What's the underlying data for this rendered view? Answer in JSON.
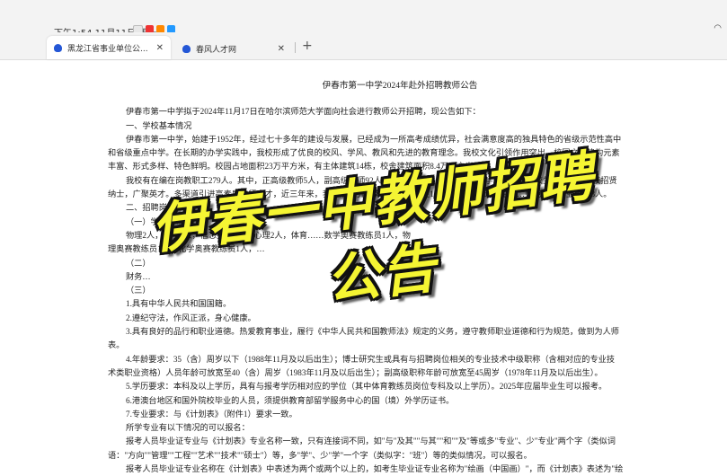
{
  "status": {
    "time": "下午1:54 11月11日 周一"
  },
  "tabs": [
    {
      "label": "黑龙江省事业单位公...",
      "close": "✕"
    },
    {
      "label": "春风人才网",
      "close": "✕"
    }
  ],
  "newtab": "+",
  "doc": {
    "title": "伊春市第一中学2024年赴外招聘教师公告",
    "lines": [
      "伊春市第一中学拟于2024年11月17日在哈尔滨师范大学面向社会进行教师公开招聘，现公告如下：",
      "一、学校基本情况",
      "伊春市第一中学，始建于1952年，经过七十多年的建设与发展，已经成为一所高考成绩优异，社会满意度高的独具特色的省级示范性高中",
      "和省级重点中学。在长期的办学实践中，我校形成了优良的校风、学风、教风和先进的教育理念。我校文化引领作用突出，校园文化建构元素",
      "丰富、形式多样、特色鲜明。校园占地面积23万平方米，有主体建筑14栋，校舍建筑面积8.4万平方米。",
      "我校有在编在岗教职工279人。其中，正高级教师5人，副高级教师92人，博士1人，硕士39人。有教学班59个，在校生2845人。我校招贤",
      "纳士，广聚英才。多渠道引进高素质教师人才，近三年来，我校成功引进南京大学博士生1人，招聘硕士研究生……师范大学毕业生103人。",
      "二、招聘岗位",
      "（一）学科岗位",
      "物理2人，化学3人，信息技术2人，心理2人，体育……数学奥赛教练员1人，物",
      "理奥赛教练员1人，化学奥赛教练员1人，…",
      "（二）",
      "财务…",
      "（三）",
      "1.具有中华人民共和国国籍。",
      "2.遵纪守法，作风正派，身心健康。",
      "3.具有良好的品行和职业道德。热爱教育事业，履行《中华人民共和国教师法》规定的义务，遵守教师职业道德和行为规范，做到为人师",
      "表。",
      "4.年龄要求：35（含）周岁以下（1988年11月及以后出生）；博士研究生或具有与招聘岗位相关的专业技术中级职称（含相对应的专业技",
      "术类职业资格）人员年龄可放宽至40（含）周岁（1983年11月及以后出生）；副高级职称年龄可放宽至45周岁（1978年11月及以后出生）。",
      "5.学历要求：本科及以上学历，具有与报考学历相对应的学位（其中体育教练员岗位专科及以上学历）。2025年应届毕业生可以报考。",
      "6.港澳台地区和国外院校毕业的人员，须提供教育部留学服务中心的国（境）外学历证书。",
      "7.专业要求：与《计划表》（附件1）要求一致。",
      "所学专业有以下情况的可以报名：",
      "报考人员毕业证专业与《计划表》专业名称一致，只有连接词不同，如\"与\"及其\"\"与其\"\"和\"\"及\"等或多\"专业\"、少\"专业\"两个字（类似词",
      "语：\"方向\"\"管理\"\"工程\"\"艺术\"\"技术\"\"硕士\"）等，多\"学\"、少\"学\"一个字（类似字：\"班\"）等的类似情况，可以报名。",
      "报考人员毕业证专业名称在《计划表》中表述为两个或两个以上的，如考生毕业证专业名称为\"绘画（中国画）\"，而《计划表》表述为\"绘"
    ]
  },
  "overlay": "伊春一中教师招聘公告"
}
